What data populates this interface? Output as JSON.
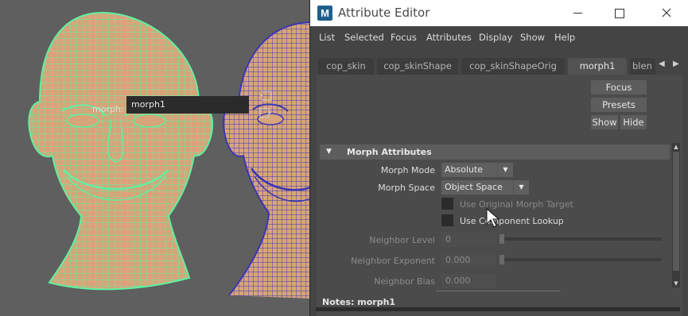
{
  "window": {
    "title": "Attribute Editor",
    "app_icon_letter": "M",
    "controls": [
      "minimize",
      "maximize",
      "close"
    ]
  },
  "menu": [
    "List",
    "Selected",
    "Focus",
    "Attributes",
    "Display",
    "Show",
    "Help"
  ],
  "tabs": [
    {
      "label": "cop_skin",
      "active": false
    },
    {
      "label": "cop_skinShape",
      "active": false
    },
    {
      "label": "cop_skinShapeOrig",
      "active": false
    },
    {
      "label": "morph1",
      "active": true
    },
    {
      "label": "blen",
      "active": false
    }
  ],
  "node": {
    "label": "morph:",
    "value": "morph1"
  },
  "buttons": {
    "focus": "Focus",
    "presets": "Presets",
    "show": "Show",
    "hide": "Hide"
  },
  "section": {
    "title": "Morph Attributes"
  },
  "attributes": {
    "morph_mode": {
      "label": "Morph Mode",
      "value": "Absolute"
    },
    "morph_space": {
      "label": "Morph Space",
      "value": "Object Space"
    },
    "use_original_target": {
      "label": "Use Original Morph Target",
      "checked": false,
      "enabled": false
    },
    "use_component_lookup": {
      "label": "Use Component Lookup",
      "checked": false,
      "enabled": true
    },
    "neighbor_level": {
      "label": "Neighbor Level",
      "value": "0",
      "slider_fraction": 0.0
    },
    "neighbor_exponent": {
      "label": "Neighbor Exponent",
      "value": "0.000",
      "slider_fraction": 0.0
    },
    "neighbor_bias": {
      "label": "Neighbor Bias",
      "value": "0.000"
    }
  },
  "notes": {
    "label": "Notes:",
    "value": "morph1"
  },
  "viewport": {
    "colors": {
      "background": "#5f5f5f",
      "skin": "#d8a479",
      "selected_wire": "#5ef0a0",
      "wire": "#3a35b5"
    }
  }
}
